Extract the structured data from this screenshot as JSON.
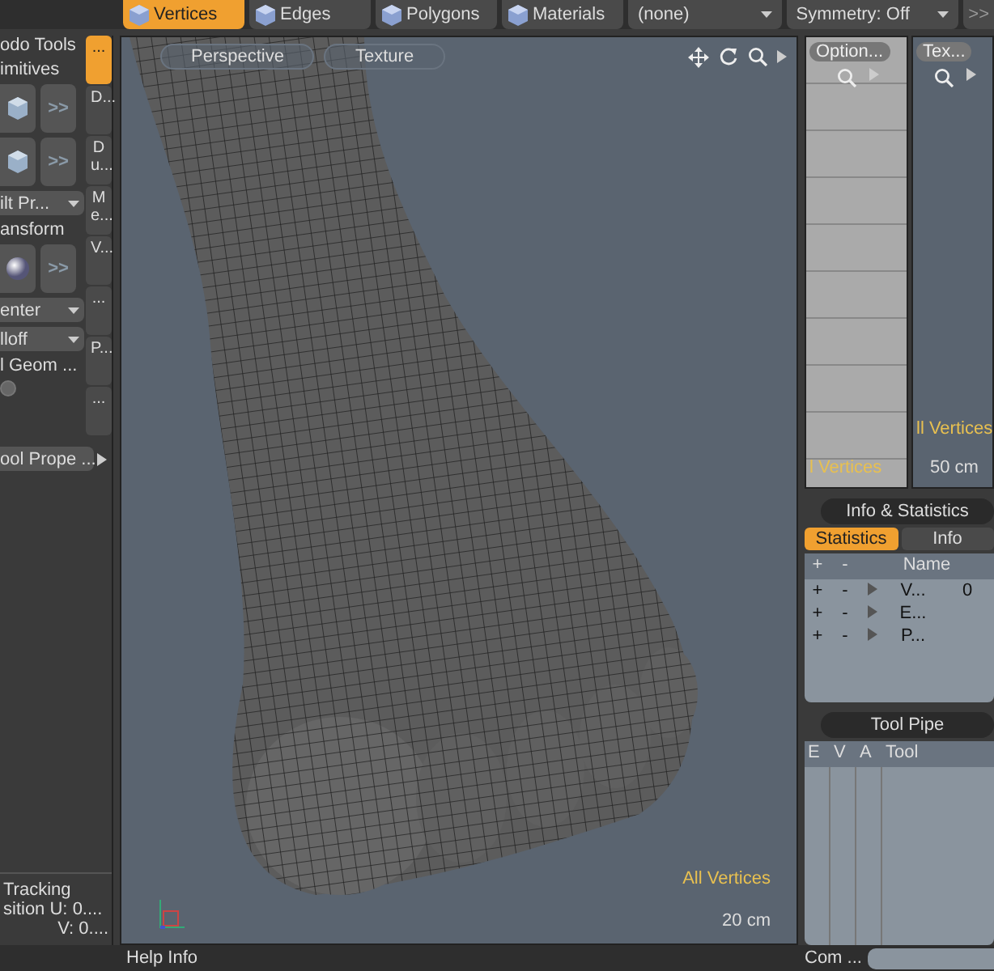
{
  "tool_panel": {
    "title": "odo Tools",
    "items": [
      {
        "kind": "header",
        "label": "imitives"
      },
      {
        "kind": "cube",
        "label": ">>"
      },
      {
        "kind": "cube",
        "label": ">>"
      },
      {
        "kind": "dropdown",
        "label": "ilt Pr..."
      },
      {
        "kind": "header",
        "label": "ansform"
      },
      {
        "kind": "sphere",
        "label": ">>"
      },
      {
        "kind": "dropdown",
        "label": "enter"
      },
      {
        "kind": "dropdown",
        "label": "lloff"
      },
      {
        "kind": "text",
        "label": "l Geom ..."
      },
      {
        "kind": "toggle"
      }
    ],
    "properties": "ool Prope ..."
  },
  "vertical_tabs": [
    {
      "label": "...",
      "selected": true
    },
    {
      "label": "D...",
      "selected": false
    },
    {
      "label": "Du...",
      "selected": false
    },
    {
      "label": "Me...",
      "selected": false
    },
    {
      "label": "V...",
      "selected": false
    },
    {
      "label": "...",
      "selected": false
    },
    {
      "label": "P...",
      "selected": false
    },
    {
      "label": "...",
      "selected": false
    }
  ],
  "tracking": {
    "title": "Tracking",
    "u_label": "sition U:",
    "u_value": "0....",
    "v_label": "V:",
    "v_value": "0...."
  },
  "selection_modes": [
    {
      "label": "Vertices",
      "selected": true
    },
    {
      "label": "Edges",
      "selected": false
    },
    {
      "label": "Polygons",
      "selected": false
    },
    {
      "label": "Materials",
      "selected": false
    }
  ],
  "toolbar_dropdowns": [
    "(none)",
    "Symmetry: Off"
  ],
  "toolbar_more": ">>",
  "viewport": {
    "view": "Perspective",
    "shading": "Texture",
    "selection_label": "All Vertices",
    "scale": "20 cm"
  },
  "mini_viewports": [
    {
      "title": "Option...",
      "label": "l Vertices",
      "kind": "uv"
    },
    {
      "title": "Tex...",
      "label": "ll Vertices",
      "scale": "50 cm",
      "kind": "ortho"
    }
  ],
  "info_panel": {
    "title": "Info & Statistics",
    "tabs": [
      {
        "label": "Statistics",
        "selected": true
      },
      {
        "label": "Info",
        "selected": false
      }
    ],
    "columns": [
      "+",
      "-",
      "Name"
    ],
    "rows": [
      {
        "add": "+",
        "remove": "-",
        "name": "V...",
        "count": "0"
      },
      {
        "add": "+",
        "remove": "-",
        "name": "E..."
      },
      {
        "add": "+",
        "remove": "-",
        "name": "P..."
      }
    ]
  },
  "tool_pipe": {
    "title": "Tool Pipe",
    "columns": [
      "E",
      "V",
      "A",
      "Tool"
    ]
  },
  "status_bar": {
    "help": "Help Info",
    "command": "Com ..."
  }
}
